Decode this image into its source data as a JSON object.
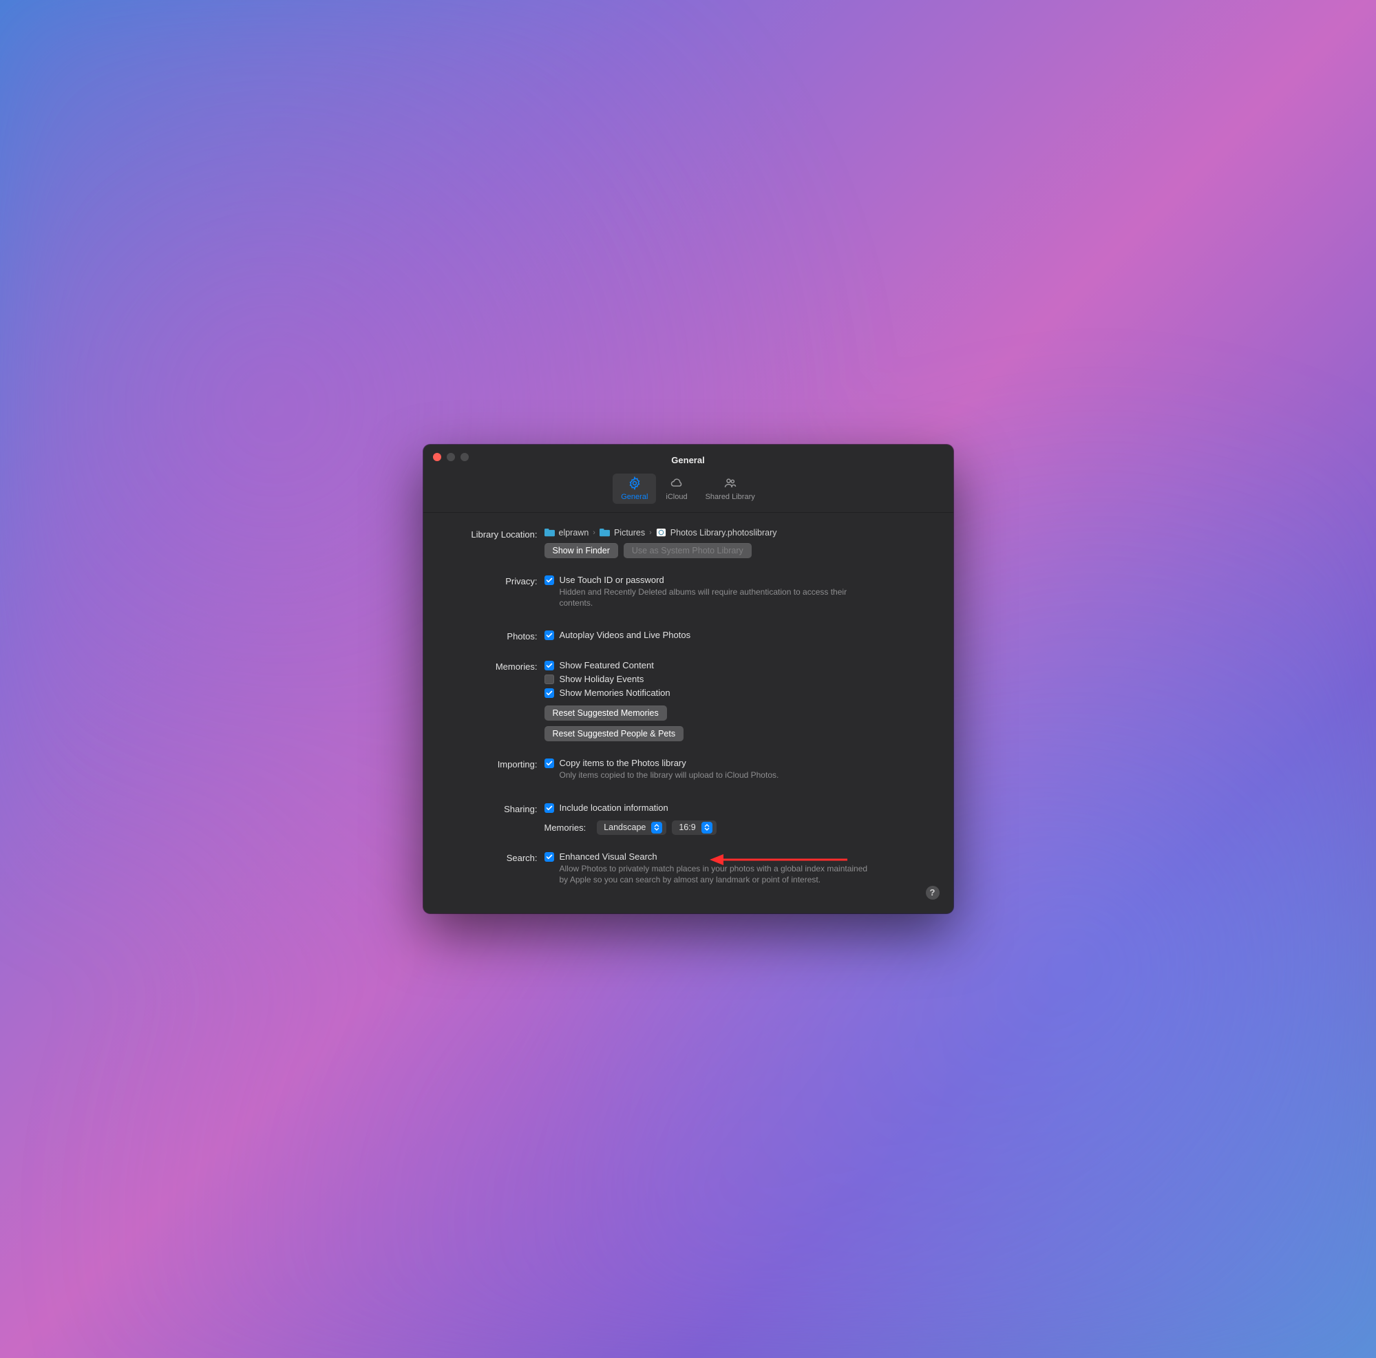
{
  "window": {
    "title": "General"
  },
  "toolbar": {
    "general": "General",
    "icloud": "iCloud",
    "shared_library": "Shared Library"
  },
  "library_location": {
    "label": "Library Location:",
    "crumbs": [
      "elprawn",
      "Pictures",
      "Photos Library.photoslibrary"
    ],
    "show_in_finder": "Show in Finder",
    "use_as_system": "Use as System Photo Library"
  },
  "privacy": {
    "label": "Privacy:",
    "option": "Use Touch ID or password",
    "desc": "Hidden and Recently Deleted albums will require authentication to access their contents."
  },
  "photos": {
    "label": "Photos:",
    "option": "Autoplay Videos and Live Photos"
  },
  "memories": {
    "label": "Memories:",
    "featured": "Show Featured Content",
    "holiday": "Show Holiday Events",
    "notification": "Show Memories Notification",
    "reset_memories": "Reset Suggested Memories",
    "reset_people": "Reset Suggested People & Pets"
  },
  "importing": {
    "label": "Importing:",
    "option": "Copy items to the Photos library",
    "desc": "Only items copied to the library will upload to iCloud Photos."
  },
  "sharing": {
    "label": "Sharing:",
    "option": "Include location information",
    "sub_label": "Memories:",
    "orientation": "Landscape",
    "aspect": "16:9"
  },
  "search": {
    "label": "Search:",
    "option": "Enhanced Visual Search",
    "desc": "Allow Photos to privately match places in your photos with a global index maintained by Apple so you can search by almost any landmark or point of interest."
  },
  "help_char": "?"
}
